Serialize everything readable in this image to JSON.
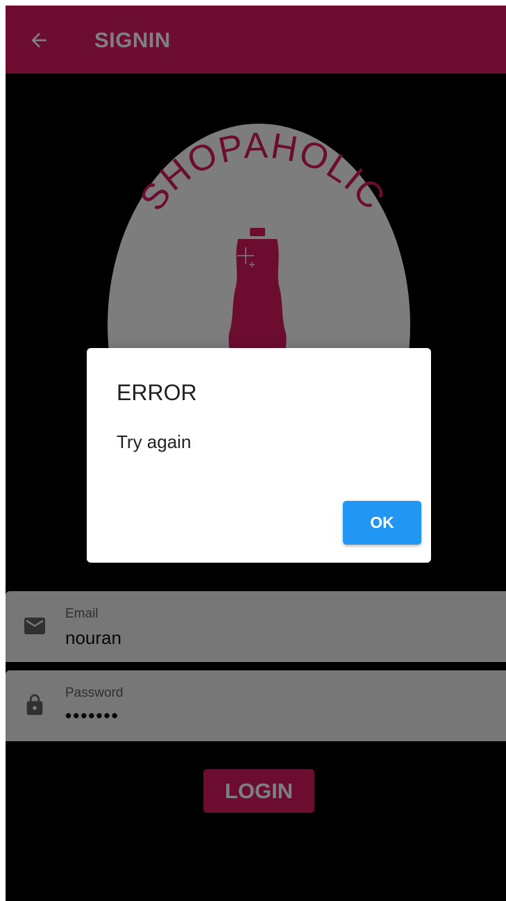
{
  "colors": {
    "primary": "#d81b60",
    "background": "#000000",
    "field_background": "#eeeeee",
    "logo_circle": "#fafafa",
    "dialog_button": "#2196f3"
  },
  "appbar": {
    "title": "SIGNIN",
    "back_icon": "arrow-back-icon"
  },
  "logo": {
    "brand_text": "SHOPAHOLIC",
    "icon": "dress-form-icon"
  },
  "form": {
    "email": {
      "label": "Email",
      "value": "nouran",
      "icon": "mail-icon"
    },
    "password": {
      "label": "Password",
      "value": "•••••••",
      "icon": "lock-icon"
    },
    "login_label": "LOGIN"
  },
  "dialog": {
    "title": "ERROR",
    "message": "Try again",
    "ok_label": "OK"
  }
}
